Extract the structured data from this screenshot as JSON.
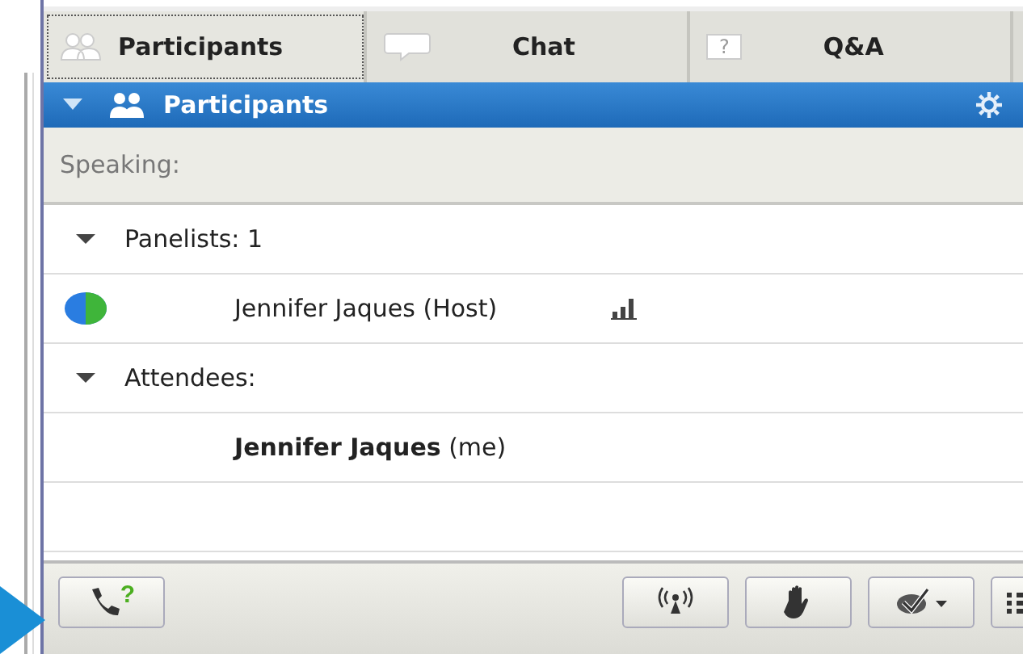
{
  "tabs": [
    {
      "label": "Participants",
      "kind": "people",
      "selected": true
    },
    {
      "label": "Chat",
      "kind": "bubble",
      "selected": false
    },
    {
      "label": "Q&A",
      "kind": "question",
      "icon_text": "?",
      "selected": false
    }
  ],
  "panel": {
    "title": "Participants",
    "expanded": true
  },
  "speaking": "Speaking:",
  "groups": [
    {
      "label": "Panelists: 1",
      "expanded": true,
      "members": [
        {
          "name": "Jennifer Jaques (Host)",
          "globe": true,
          "signal": true
        }
      ]
    },
    {
      "label": "Attendees:",
      "expanded": true,
      "members": [
        {
          "name": "**Jennifer Jaques** (me)",
          "globe": false,
          "signal": false
        }
      ]
    }
  ],
  "toolbar": {
    "call_help": "?",
    "buttons": [
      {
        "kind": "broadcast"
      },
      {
        "kind": "hand"
      },
      {
        "kind": "check"
      },
      {
        "kind": "list"
      }
    ]
  }
}
